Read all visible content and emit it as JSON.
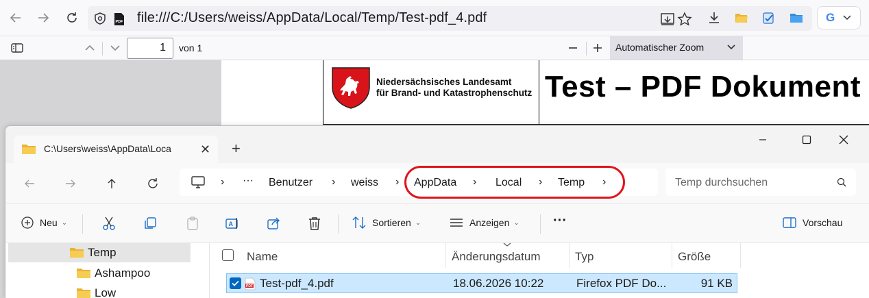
{
  "browser": {
    "url": "file:///C:/Users/weiss/AppData/Local/Temp/Test-pdf_4.pdf",
    "google_label": "G"
  },
  "pdf_toolbar": {
    "page_number": "1",
    "page_of": "von 1",
    "zoom": "Automatischer Zoom"
  },
  "pdf": {
    "org_line1": "Niedersächsisches Landesamt",
    "org_line2": "für Brand- und Katastrophenschutz",
    "title": "Test – PDF Dokument"
  },
  "explorer": {
    "tab_title": "C:\\Users\\weiss\\AppData\\Loca",
    "breadcrumb": [
      "Benutzer",
      "weiss",
      "AppData",
      "Local",
      "Temp"
    ],
    "search_placeholder": "Temp durchsuchen",
    "commands": {
      "new": "Neu",
      "sort": "Sortieren",
      "view": "Anzeigen",
      "more": "···",
      "preview": "Vorschau"
    },
    "nav_items": [
      "Temp",
      "Ashampoo",
      "Low"
    ],
    "columns": [
      "Name",
      "Änderungsdatum",
      "Typ",
      "Größe"
    ],
    "files": [
      {
        "name": "Test-pdf_4.pdf",
        "date": "18.06.2026 10:22",
        "type": "Firefox PDF Do...",
        "size": "91 KB",
        "selected": true
      }
    ]
  },
  "colors": {
    "annotation": "#e2141b",
    "selection": "#cce8ff",
    "accent": "#0067c0"
  }
}
